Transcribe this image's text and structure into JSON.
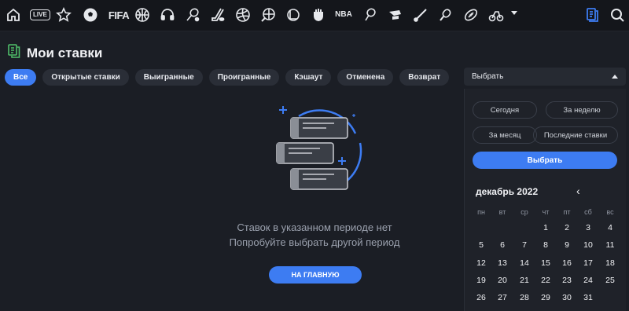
{
  "nav": {
    "live_label": "LIVE",
    "fifa_label": "FIFA",
    "nba_label": "NBA"
  },
  "page": {
    "title": "Мои ставки"
  },
  "filters": [
    {
      "label": "Все",
      "active": true
    },
    {
      "label": "Открытые ставки",
      "active": false
    },
    {
      "label": "Выигранные",
      "active": false
    },
    {
      "label": "Проигранные",
      "active": false
    },
    {
      "label": "Кэшаут",
      "active": false
    },
    {
      "label": "Отменена",
      "active": false
    },
    {
      "label": "Возврат",
      "active": false
    }
  ],
  "empty": {
    "line1": "Ставок в указанном периоде нет",
    "line2": "Попробуйте выбрать другой период",
    "home_button": "НА ГЛАВНУЮ"
  },
  "picker": {
    "select_label": "Выбрать",
    "presets": [
      "Сегодня",
      "За неделю",
      "За месяц",
      "Последние ставки"
    ],
    "apply_label": "Выбрать",
    "month": "декабрь 2022",
    "prev_icon": "‹",
    "weekdays": [
      "пн",
      "вт",
      "ср",
      "чт",
      "пт",
      "сб",
      "вс"
    ],
    "days": [
      "1",
      "2",
      "3",
      "4",
      "5",
      "6",
      "7",
      "8",
      "9",
      "10",
      "11",
      "12",
      "13",
      "14",
      "15",
      "16",
      "17",
      "18",
      "19",
      "20",
      "21",
      "22",
      "23",
      "24",
      "25",
      "26",
      "27",
      "28",
      "29",
      "30",
      "31"
    ]
  },
  "colors": {
    "accent": "#3d7cf2",
    "background": "#1b1e25",
    "chip": "#2a2e37"
  }
}
